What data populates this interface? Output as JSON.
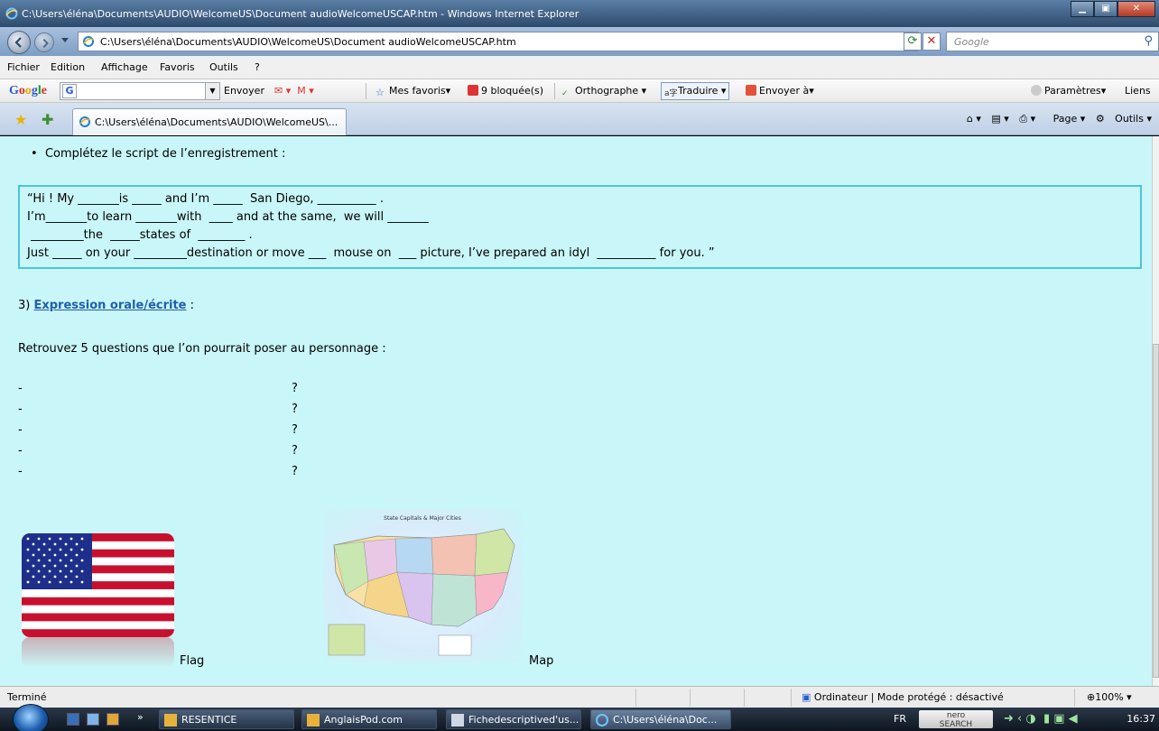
{
  "window": {
    "title": "C:\\Users\\éléna\\Documents\\AUDIO\\WelcomeUS\\Document audioWelcomeUSCAP.htm - Windows Internet Explorer"
  },
  "address": {
    "url": "C:\\Users\\éléna\\Documents\\AUDIO\\WelcomeUS\\Document audioWelcomeUSCAP.htm",
    "search_placeholder": "Google"
  },
  "menu": {
    "items": [
      "Fichier",
      "Edition",
      "Affichage",
      "Favoris",
      "Outils",
      "?"
    ]
  },
  "google_toolbar": {
    "envoyer": "Envoyer",
    "mes_favoris": "Mes favoris",
    "bloquees": "9 bloquée(s)",
    "orthographe": "Orthographe",
    "traduire": "Traduire",
    "envoyer_a": "Envoyer à",
    "parametres": "Paramètres",
    "liens": "Liens"
  },
  "tabs": {
    "active_label": "C:\\Users\\éléna\\Documents\\AUDIO\\WelcomeUS\\...",
    "page": "Page",
    "outils": "Outils"
  },
  "content": {
    "bullet": "Complétez le script de l’enregistrement :",
    "script_lines": [
      "“Hi ! My _______is _____ and I’m _____  San Diego, __________ .",
      "I’m_______to learn _______with  ____ and at the same,  we will _______",
      " _________the  _____states of  ________ .",
      "Just _____ on your _________destination or move ___  mouse on  ___ picture, I’ve prepared an idyl  __________ for you. ”"
    ],
    "section_number": "3)",
    "section_link": "Expression orale/écrite",
    "section_colon": ":",
    "questions_title": "Retrouvez 5 questions que l’on pourrait poser au personnage :",
    "question_dash": "-",
    "question_mark": "?",
    "flag_caption": "Flag",
    "map_caption": "Map",
    "map_title": "State Capitals & Major Cities"
  },
  "status": {
    "text": "Terminé",
    "zone": "Ordinateur | Mode protégé : désactivé",
    "zoom": "100%"
  },
  "taskbar": {
    "buttons": [
      "RESENTICE",
      "AnglaisPod.com",
      "Fichedescriptived'us...",
      "C:\\Users\\éléna\\Doc..."
    ],
    "lang": "FR",
    "nero": "nero",
    "nero_sub": "SEARCH",
    "clock": "16:37"
  }
}
